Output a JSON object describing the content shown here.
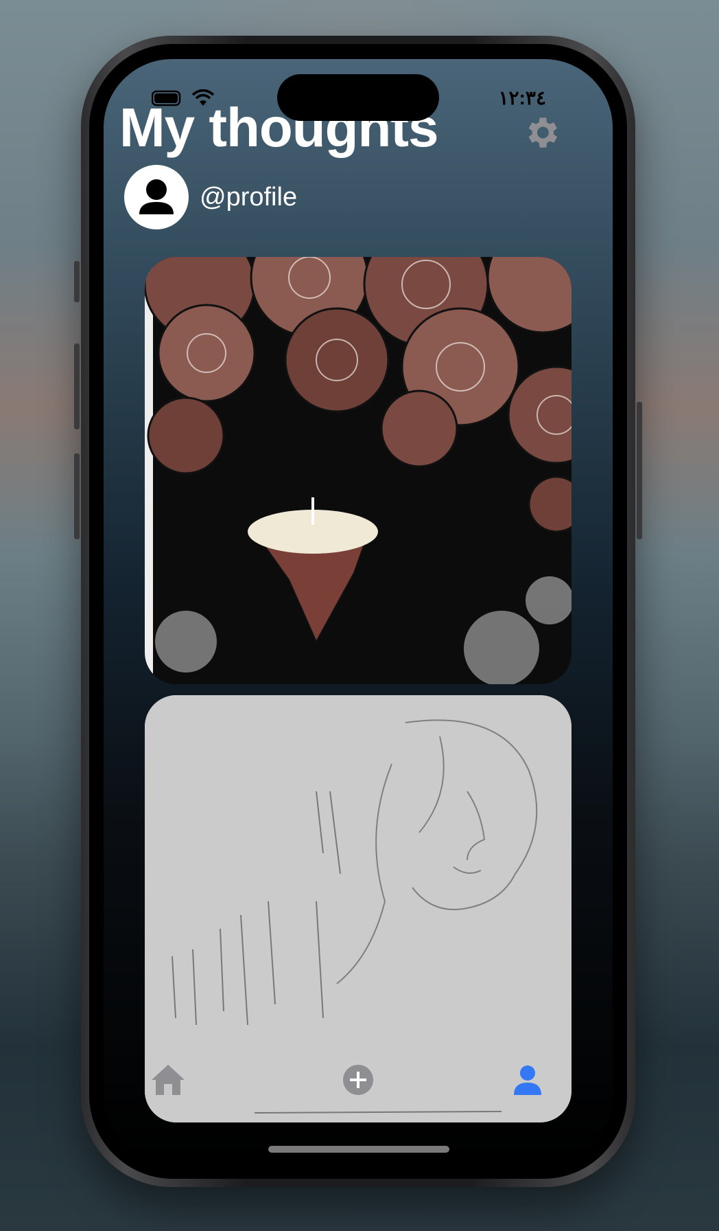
{
  "status_bar": {
    "time": "١٢:٣٤"
  },
  "header": {
    "title": "My thoughts",
    "username": "@profile"
  },
  "feed": {
    "items": [
      {
        "type": "drawing",
        "description": "spiral clouds over floating island"
      },
      {
        "type": "sketch",
        "description": "pencil face sketch with handwritten notes"
      }
    ]
  },
  "tab_bar": {
    "items": [
      "home",
      "add",
      "profile"
    ],
    "active": "profile"
  },
  "colors": {
    "accent": "#3478f6",
    "icon_gray": "#8e8e93"
  }
}
